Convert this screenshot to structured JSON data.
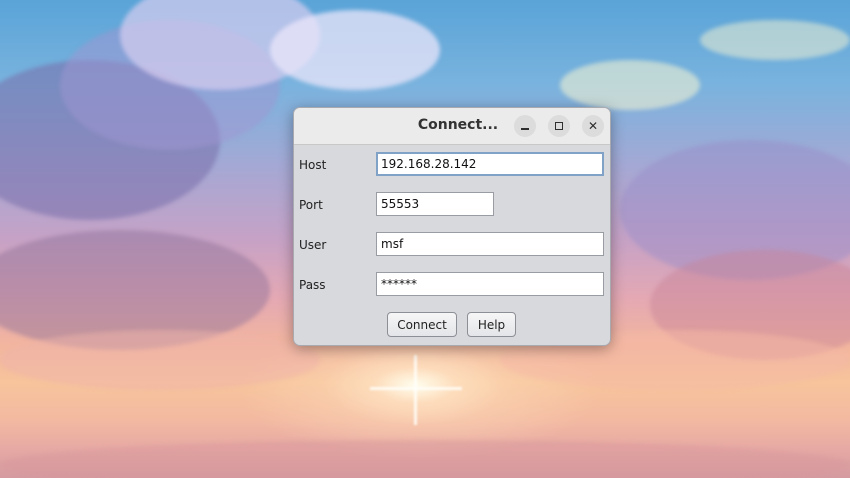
{
  "dialog": {
    "title": "Connect...",
    "window_controls": {
      "minimize_icon": "minimize-icon",
      "maximize_icon": "maximize-icon",
      "close_icon": "close-icon",
      "close_glyph": "✕"
    },
    "fields": {
      "host": {
        "label": "Host",
        "value": "192.168.28.142"
      },
      "port": {
        "label": "Port",
        "value": "55553"
      },
      "user": {
        "label": "User",
        "value": "msf"
      },
      "pass": {
        "label": "Pass",
        "value": "******"
      }
    },
    "buttons": {
      "connect": "Connect",
      "help": "Help"
    }
  },
  "colors": {
    "dialog_bg": "#d8d9dd",
    "titlebar_bg": "#ebebeb",
    "focus_border": "#7fa2c6"
  }
}
